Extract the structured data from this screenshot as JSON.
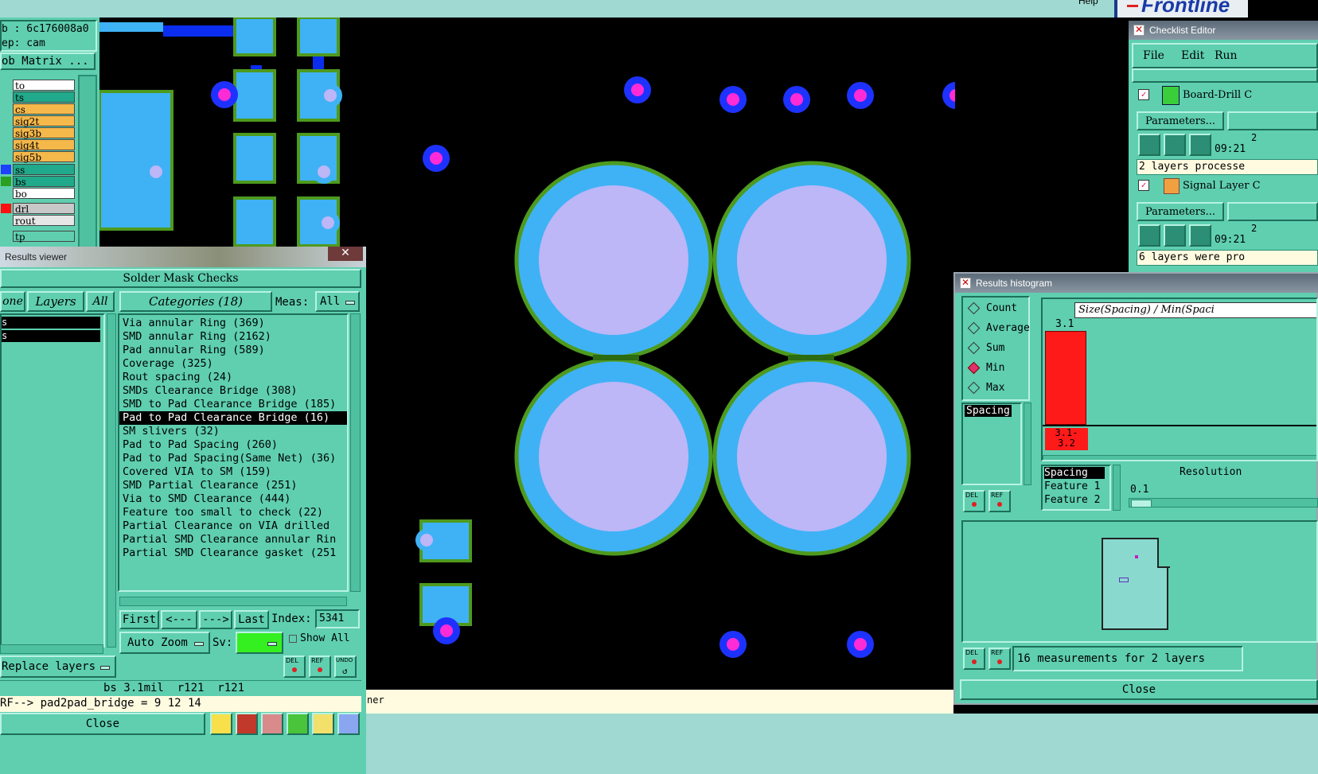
{
  "menubar": {
    "items": [
      "",
      "",
      "",
      "",
      "",
      "",
      "",
      "",
      "",
      "Help"
    ],
    "logo": "Frontline"
  },
  "job": {
    "job_id": "b : 6c176008a0",
    "step": "ep: cam",
    "matrix_btn": "ob Matrix ..."
  },
  "layers": [
    {
      "name": "to",
      "color": "#ffffff",
      "swatch": ""
    },
    {
      "name": "ts",
      "color": "#20a98a",
      "swatch": ""
    },
    {
      "name": "cs",
      "color": "#f5b84a",
      "swatch": ""
    },
    {
      "name": "sig2t",
      "color": "#f5b84a",
      "swatch": ""
    },
    {
      "name": "sig3b",
      "color": "#f5b84a",
      "swatch": ""
    },
    {
      "name": "sig4t",
      "color": "#f5b84a",
      "swatch": ""
    },
    {
      "name": "sig5b",
      "color": "#f5b84a",
      "swatch": ""
    },
    {
      "name": "ss",
      "color": "#20a98a",
      "swatch": "#1e40ff"
    },
    {
      "name": "bs",
      "color": "#20a98a",
      "swatch": "#2aa020"
    },
    {
      "name": "bo",
      "color": "#ffffff",
      "swatch": ""
    },
    {
      "name": "drl",
      "color": "#c8c8c8",
      "swatch": "#ff1010"
    },
    {
      "name": "rout",
      "color": "#e6e6e6",
      "swatch": ""
    },
    {
      "name": "tp",
      "color": "#5fcfb0",
      "swatch": ""
    }
  ],
  "results_viewer": {
    "title": "Results viewer",
    "heading": "Solder Mask Checks",
    "done_btn": "one",
    "layers_btn": "Layers",
    "all_btn": "All",
    "categories_btn": "Categories (18)",
    "meas_label": "Meas:",
    "meas_value": "All",
    "layer_list": [
      "s",
      "s"
    ],
    "categories": [
      "Via annular Ring (369)",
      "SMD annular Ring (2162)",
      "Pad annular Ring (589)",
      "Coverage (325)",
      "Rout spacing (24)",
      "SMDs Clearance Bridge (308)",
      "SMD to Pad Clearance Bridge (185)",
      "Pad to Pad Clearance Bridge (16)",
      "SM slivers (32)",
      "Pad to Pad Spacing (260)",
      "Pad to Pad Spacing(Same Net) (36)",
      "Covered VIA to SM (159)",
      "SMD Partial Clearance (251)",
      "Via to SMD Clearance (444)",
      "Feature too small to check (22)",
      "Partial Clearance on VIA drilled",
      "Partial SMD Clearance annular Rin",
      "Partial SMD Clearance gasket (251"
    ],
    "selected_index": 7,
    "nav": {
      "first": "First",
      "prev": "<---",
      "next": "--->",
      "last": "Last",
      "index_label": "Index:",
      "index_value": "5341"
    },
    "auto_zoom": "Auto Zoom",
    "sv_label": "Sv:",
    "show_all": "Show All",
    "replace_layers": "Replace layers",
    "del": "DEL",
    "ref": "REF",
    "undo": "UNDO",
    "status1": "bs 3.1mil  r121  r121",
    "status2": "RF--> pad2pad_bridge = 9 12 14",
    "close": "Close"
  },
  "bottom_msg": "ner",
  "checklist": {
    "title": "Checklist Editor",
    "menu": [
      "File",
      "Edit",
      "Run"
    ],
    "items": [
      {
        "name": "Board-Drill C",
        "params": "Parameters...",
        "time": "09:21",
        "time_top": "2",
        "status": "2 layers processe"
      },
      {
        "name": "Signal Layer C",
        "params": "Parameters...",
        "time": "09:21",
        "time_top": "2",
        "status": "6 layers were pro"
      }
    ]
  },
  "histogram": {
    "title": "Results histogram",
    "modes": [
      "Count",
      "Average",
      "Sum",
      "Min",
      "Max"
    ],
    "selected_mode": "Min",
    "chart_title": "Size(Spacing) / Min(Spaci",
    "bar_value_label": "3.1",
    "bar_range_label_1": "3.1-",
    "bar_range_label_2": "3.2",
    "list_item": "Spacing",
    "fields": [
      "Spacing",
      "Feature 1",
      "Feature 2"
    ],
    "resolution_label": "Resolution",
    "resolution_value": "0.1",
    "summary": "16 measurements for 2 layers",
    "close": "Close",
    "del": "DEL",
    "ref": "REF",
    "chart_data": {
      "type": "bar",
      "categories": [
        "3.1-3.2"
      ],
      "values": [
        16
      ],
      "title": "Size(Spacing) / Min(Spaci"
    }
  },
  "colors": {
    "panel": "#5fcfb0",
    "copper": "#3fb2f5",
    "mask": "#4e9a1e",
    "drill": "#bdb6f7",
    "via_ring": "#1e32ff",
    "via_hole": "#ff2bd6",
    "trace": "#0a2df0"
  }
}
